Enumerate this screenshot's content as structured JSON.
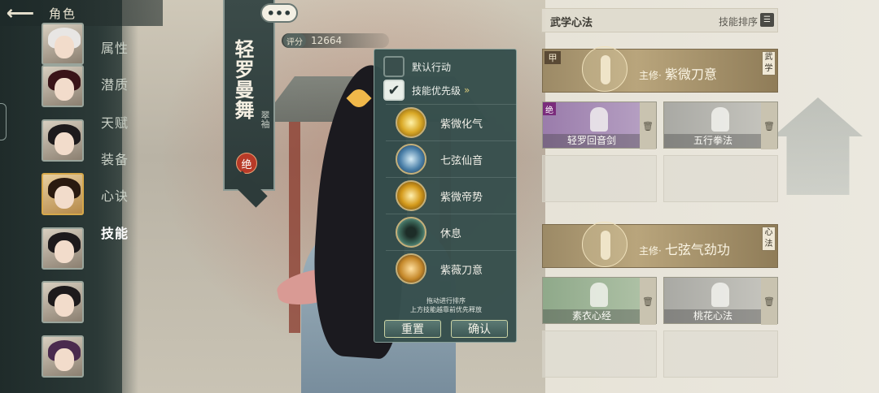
{
  "topbar": {
    "back_icon": "back-arrow-icon",
    "title": "角色"
  },
  "nav": {
    "items": [
      {
        "label": "属性"
      },
      {
        "label": "潜质"
      },
      {
        "label": "天赋"
      },
      {
        "label": "装备"
      },
      {
        "label": "心诀"
      },
      {
        "label": "技能",
        "active": true
      }
    ]
  },
  "character": {
    "name": "轻罗曼舞",
    "sect": "翠袖",
    "seal": "绝",
    "chat_icon": "•••",
    "score_label": "评分",
    "score_value": "12664"
  },
  "popup": {
    "default_action": {
      "label": "默认行动",
      "checked": false
    },
    "skill_priority": {
      "label": "技能优先级",
      "checked": true,
      "chevron": "»"
    },
    "skills": [
      {
        "name": "紫微化气",
        "icon": "golden-burst-icon",
        "color": "#d9a826"
      },
      {
        "name": "七弦仙音",
        "icon": "blue-swirl-icon",
        "color": "#4a7fa8"
      },
      {
        "name": "紫微帝势",
        "icon": "golden-orb-icon",
        "color": "#d49a1c"
      },
      {
        "name": "休息",
        "icon": "meditation-icon",
        "color": "#3f6d5e"
      },
      {
        "name": "紫薇刀意",
        "icon": "blade-sweep-icon",
        "color": "#c5882a"
      }
    ],
    "hint_line1": "拖动进行排序",
    "hint_line2": "上方技能越靠前优先释放",
    "reset_label": "重置",
    "confirm_label": "确认"
  },
  "right_panel": {
    "title": "武学心法",
    "sort_label": "技能排序",
    "sort_icon": "sort-list-icon",
    "martial": {
      "rank": "甲",
      "main_prefix": "主修·",
      "main_name": "紫微刀意",
      "tag": "武学",
      "slots": [
        {
          "name": "轻罗回音剑",
          "badge": "绝",
          "color": "purple"
        },
        {
          "name": "五行拳法",
          "color": "gray"
        }
      ]
    },
    "mind": {
      "main_prefix": "主修·",
      "main_name": "七弦气劲功",
      "tag": "心法",
      "slots": [
        {
          "name": "素衣心经",
          "color": "green"
        },
        {
          "name": "桃花心法",
          "color": "gray"
        }
      ]
    },
    "trash_icon": "trash-icon",
    "accent_color": "#b9a57c"
  }
}
